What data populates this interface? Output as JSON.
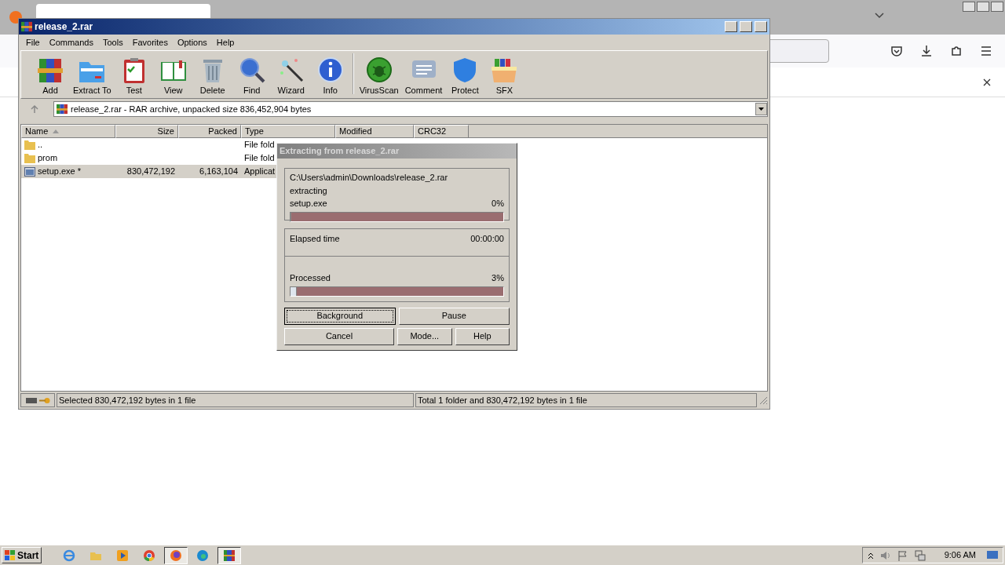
{
  "window": {
    "title": "release_2.rar"
  },
  "menu": [
    "File",
    "Commands",
    "Tools",
    "Favorites",
    "Options",
    "Help"
  ],
  "toolbar": [
    {
      "label": "Add",
      "kind": "books"
    },
    {
      "label": "Extract To",
      "kind": "folder"
    },
    {
      "label": "Test",
      "kind": "clipboard"
    },
    {
      "label": "View",
      "kind": "book"
    },
    {
      "label": "Delete",
      "kind": "trash"
    },
    {
      "label": "Find",
      "kind": "magnifier"
    },
    {
      "label": "Wizard",
      "kind": "wand"
    },
    {
      "label": "Info",
      "kind": "info"
    },
    {
      "label": "VirusScan",
      "kind": "bug"
    },
    {
      "label": "Comment",
      "kind": "note"
    },
    {
      "label": "Protect",
      "kind": "shield"
    },
    {
      "label": "SFX",
      "kind": "box"
    }
  ],
  "path_bar": "release_2.rar - RAR archive, unpacked size 836,452,904 bytes",
  "table": {
    "columns": [
      {
        "label": "Name",
        "sorted": true
      },
      {
        "label": "Size",
        "sorted": false
      },
      {
        "label": "Packed",
        "sorted": false
      },
      {
        "label": "Type",
        "sorted": false
      },
      {
        "label": "Modified",
        "sorted": false
      },
      {
        "label": "CRC32",
        "sorted": false
      }
    ],
    "rows": [
      {
        "kind": "folder",
        "name": "..",
        "type": "File fold",
        "selected": false
      },
      {
        "kind": "folder",
        "name": "prom",
        "type": "File fold",
        "selected": false
      },
      {
        "kind": "exe",
        "name": "setup.exe *",
        "size": "830,472,192",
        "packed": "6,163,104",
        "type": "Applicat",
        "selected": true
      }
    ]
  },
  "status": [
    "Selected 830,472,192 bytes in 1 file",
    "Total 1 folder and 830,472,192 bytes in 1 file"
  ],
  "dialog": {
    "title": "Extracting from release_2.rar",
    "path": "C:\\Users\\admin\\Downloads\\release_2.rar",
    "action": "extracting",
    "file": "setup.exe",
    "file_progress": {
      "percent": "0%",
      "level": 0
    },
    "elapsed_label": "Elapsed time",
    "elapsed": "00:00:00",
    "processed_label": "Processed",
    "processed_progress": {
      "percent": "3%",
      "level": 0.03
    },
    "buttons": [
      {
        "label": "Background",
        "focused": true
      },
      {
        "label": "Pause",
        "focused": false
      },
      {
        "label": "Cancel",
        "focused": false
      },
      {
        "label": "Mode...",
        "focused": false
      },
      {
        "label": "Help",
        "focused": false
      }
    ]
  },
  "taskbar": {
    "start": "Start",
    "apps": [
      {
        "kind": "ie",
        "active": false
      },
      {
        "kind": "explorer",
        "active": false
      },
      {
        "kind": "media",
        "active": false
      },
      {
        "kind": "chrome",
        "active": false
      },
      {
        "kind": "firefox",
        "active": true
      },
      {
        "kind": "edge",
        "active": false
      },
      {
        "kind": "winrar",
        "active": true
      }
    ],
    "clock": "9:06 AM"
  }
}
